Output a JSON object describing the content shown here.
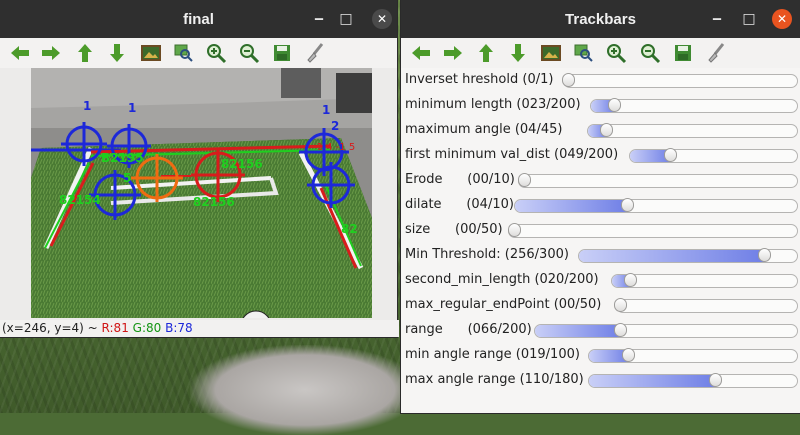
{
  "final_window": {
    "title": "final",
    "toolbar_icons": [
      "arrow-left-icon",
      "arrow-right-icon",
      "arrow-up-icon",
      "arrow-down-icon",
      "image-icon",
      "zoom-fit-icon",
      "zoom-in-icon",
      "zoom-out-icon",
      "save-icon",
      "brush-icon"
    ],
    "overlay_labels": [
      "1",
      "1",
      "1",
      "2",
      "B2195",
      "82156",
      "82154",
      "82",
      "5"
    ],
    "overlay_dim_text": "-1 4 -1 5",
    "status": {
      "coords": "(x=246, y=4) ~",
      "r": "R:81",
      "g": "G:80",
      "b": "B:78"
    }
  },
  "trackbars_window": {
    "title": "Trackbars",
    "toolbar_icons": [
      "arrow-left-icon",
      "arrow-right-icon",
      "arrow-up-icon",
      "arrow-down-icon",
      "image-icon",
      "zoom-fit-icon",
      "zoom-in-icon",
      "zoom-out-icon",
      "save-icon",
      "brush-icon"
    ],
    "sliders": [
      {
        "label": "Inverset hreshold (0/1)",
        "value": 0,
        "max": 1
      },
      {
        "label": "minimum length (023/200)",
        "value": 23,
        "max": 200
      },
      {
        "label": "maximum angle (04/45)",
        "value": 4,
        "max": 45
      },
      {
        "label": "first minimum val_dist (049/200)",
        "value": 49,
        "max": 200
      },
      {
        "label": "Erode      (00/10)",
        "value": 0,
        "max": 10
      },
      {
        "label": "dilate      (04/10)",
        "value": 4,
        "max": 10
      },
      {
        "label": "size      (00/50)",
        "value": 0,
        "max": 50
      },
      {
        "label": "Min Threshold: (256/300)",
        "value": 256,
        "max": 300
      },
      {
        "label": "second_min_length (020/200)",
        "value": 20,
        "max": 200
      },
      {
        "label": "max_regular_endPoint (00/50)",
        "value": 0,
        "max": 50
      },
      {
        "label": "range      (066/200)",
        "value": 66,
        "max": 200
      },
      {
        "label": "min angle range (019/100)",
        "value": 19,
        "max": 100
      },
      {
        "label": "max angle range (110/180)",
        "value": 110,
        "max": 180
      }
    ]
  },
  "colors": {
    "accent": "#e95420",
    "slider_fill": "#6f7fe6",
    "titlebar": "#2f2f2f"
  }
}
